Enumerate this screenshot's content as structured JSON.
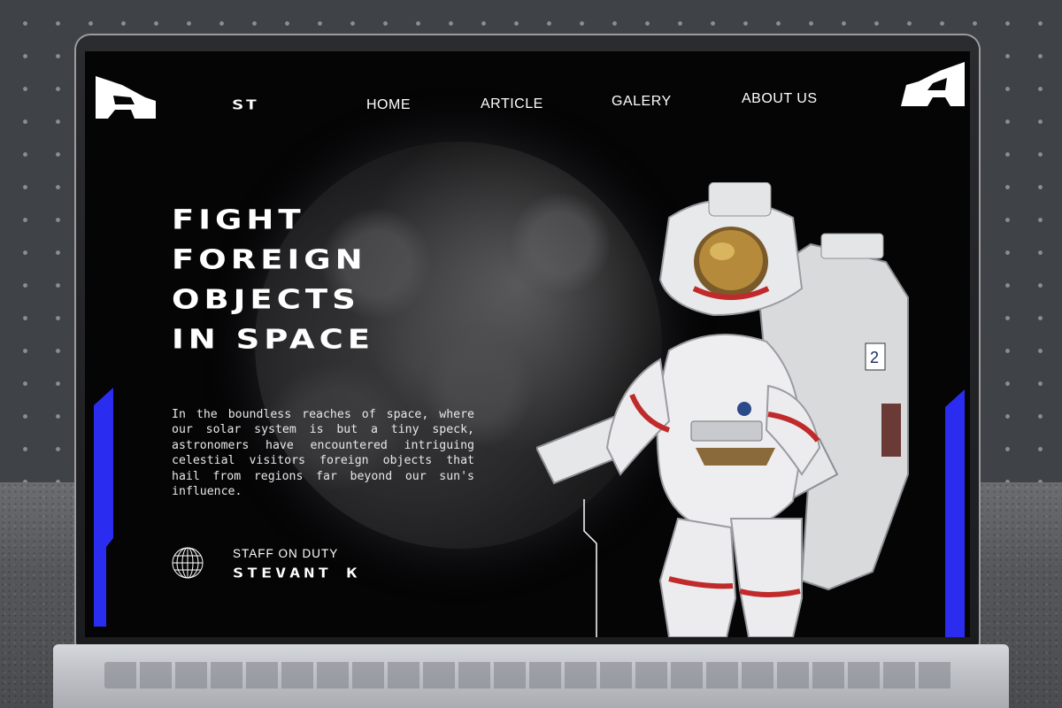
{
  "nav": {
    "brand": "ST",
    "links": [
      "HOME",
      "ARTICLE",
      "GALERY",
      "ABOUT US"
    ]
  },
  "hero": {
    "title_lines": [
      "FIGHT",
      "FOREIGN",
      "OBJECTS",
      "IN SPACE"
    ],
    "description": "In the boundless reaches of space, where our solar system is but a tiny speck, astronomers have encountered intriguing celestial visitors foreign objects that hail from regions far beyond our sun's influence."
  },
  "staff": {
    "label": "STAFF ON DUTY",
    "name": "STEVANT K"
  },
  "colors": {
    "accent": "#2a2df0",
    "screen_bg": "#050506",
    "text": "#ffffff"
  },
  "icons": {
    "logo_left": "angular-logo-mark",
    "logo_right": "angular-logo-mark",
    "staff": "wireframe-globe-icon"
  }
}
